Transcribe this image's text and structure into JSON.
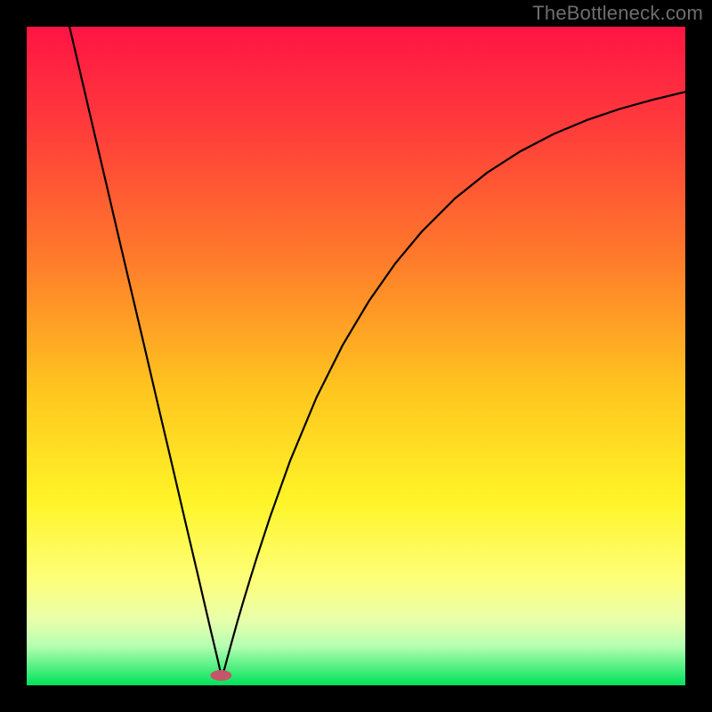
{
  "watermark": "TheBottleneck.com",
  "chart_data": {
    "type": "line",
    "title": "",
    "xlabel": "",
    "ylabel": "",
    "xlim": [
      0,
      100
    ],
    "ylim": [
      0,
      100
    ],
    "grid": false,
    "legend": false,
    "background": {
      "gradient_stops": [
        {
          "pos": 0.0,
          "color": "#ff1445"
        },
        {
          "pos": 0.15,
          "color": "#ff3b3b"
        },
        {
          "pos": 0.35,
          "color": "#ff7a2b"
        },
        {
          "pos": 0.55,
          "color": "#ffc51f"
        },
        {
          "pos": 0.72,
          "color": "#fff428"
        },
        {
          "pos": 0.84,
          "color": "#fdff7a"
        },
        {
          "pos": 0.9,
          "color": "#e9ffab"
        },
        {
          "pos": 0.94,
          "color": "#b6ffb2"
        },
        {
          "pos": 1.0,
          "color": "#00e35a"
        }
      ]
    },
    "optimum": {
      "x": 29.5,
      "y": 1.5,
      "color": "#c5566a"
    },
    "series": [
      {
        "name": "bottleneck-curve",
        "color": "#000000",
        "x": [
          6.5,
          8,
          10,
          12,
          14,
          16,
          18,
          20,
          22,
          24,
          26,
          27,
          28,
          29,
          29.5,
          30,
          31,
          32,
          33,
          34,
          35,
          37,
          40,
          44,
          48,
          52,
          56,
          60,
          65,
          70,
          75,
          80,
          85,
          90,
          95,
          100
        ],
        "y": [
          100,
          93.6,
          85.0,
          76.5,
          67.9,
          59.4,
          50.9,
          42.3,
          33.8,
          25.2,
          16.7,
          12.4,
          8.1,
          3.9,
          1.7,
          2.4,
          6.1,
          9.7,
          13.1,
          16.4,
          19.6,
          25.7,
          34.1,
          43.7,
          51.7,
          58.4,
          64.1,
          68.9,
          73.9,
          77.9,
          81.1,
          83.7,
          85.8,
          87.5,
          88.9,
          90.1
        ]
      }
    ]
  }
}
